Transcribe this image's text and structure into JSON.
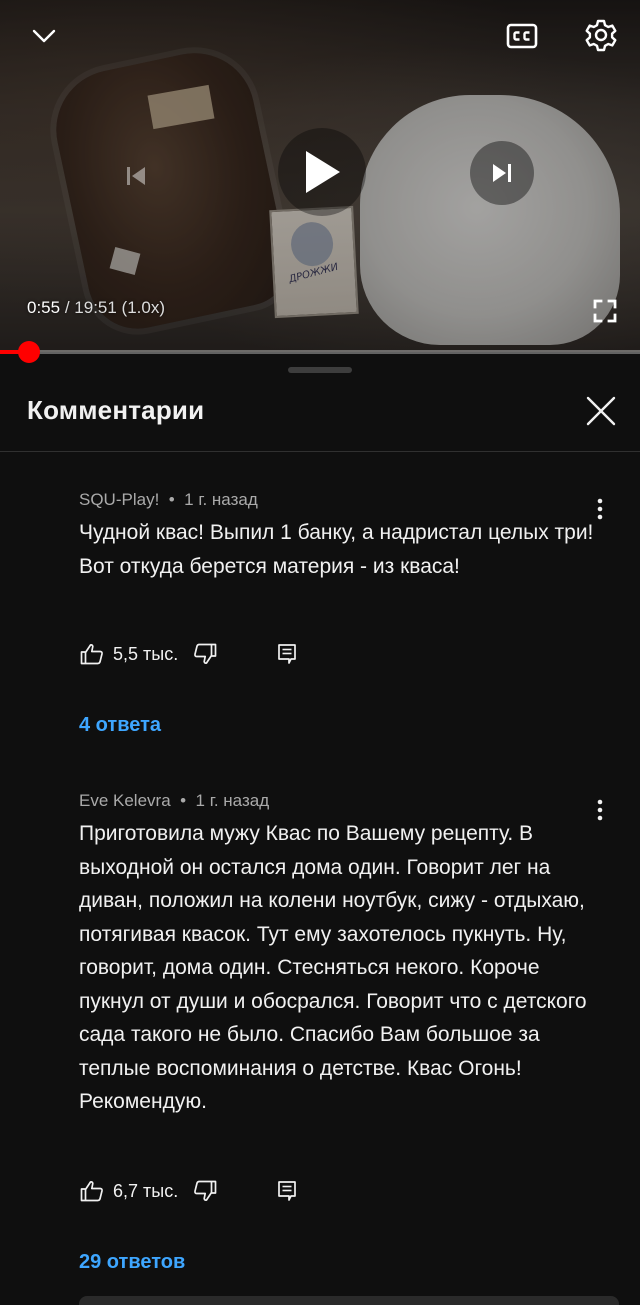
{
  "player": {
    "time_current": "0:55",
    "time_separator": "/",
    "time_total": "19:51 (1.0x)",
    "progress_fraction": 0.046,
    "yeast_pack_text": "ДРОЖЖИ",
    "icons": {
      "collapse": "chevron-down-icon",
      "captions": "cc-icon",
      "settings": "gear-icon",
      "previous": "skip-previous-icon",
      "play": "play-icon",
      "next": "skip-next-icon",
      "fullscreen": "fullscreen-icon"
    },
    "accent_color": "#ff0000"
  },
  "comments_panel": {
    "title": "Комментарии",
    "close_icon": "close-icon",
    "comments": [
      {
        "author": "SQU-Play!",
        "time": "1 г. назад",
        "text": "Чудной квас! Выпил 1 банку, а надристал целых три! Вот откуда берется материя - из кваса!",
        "likes": "5,5 тыс.",
        "replies": "4 ответа"
      },
      {
        "author": "Eve Kelevra",
        "time": "1 г. назад",
        "text": "Приготовила мужу Квас по Вашему рецепту. В выходной он остался дома один. Говорит лег на диван, положил на колени ноутбук, сижу - отдыхаю, потягивая квасок. Тут ему захотелось пукнуть. Ну, говорит, дома один. Стесняться некого. Короче пукнул от души и обосрался. Говорит что с детского сада такого не было. Спасибо Вам большое за теплые воспоминания о детстве. Квас Огонь! Рекомендую.",
        "likes": "6,7 тыс.",
        "replies": "29 ответов"
      }
    ],
    "replies_color": "#3ea6ff"
  }
}
